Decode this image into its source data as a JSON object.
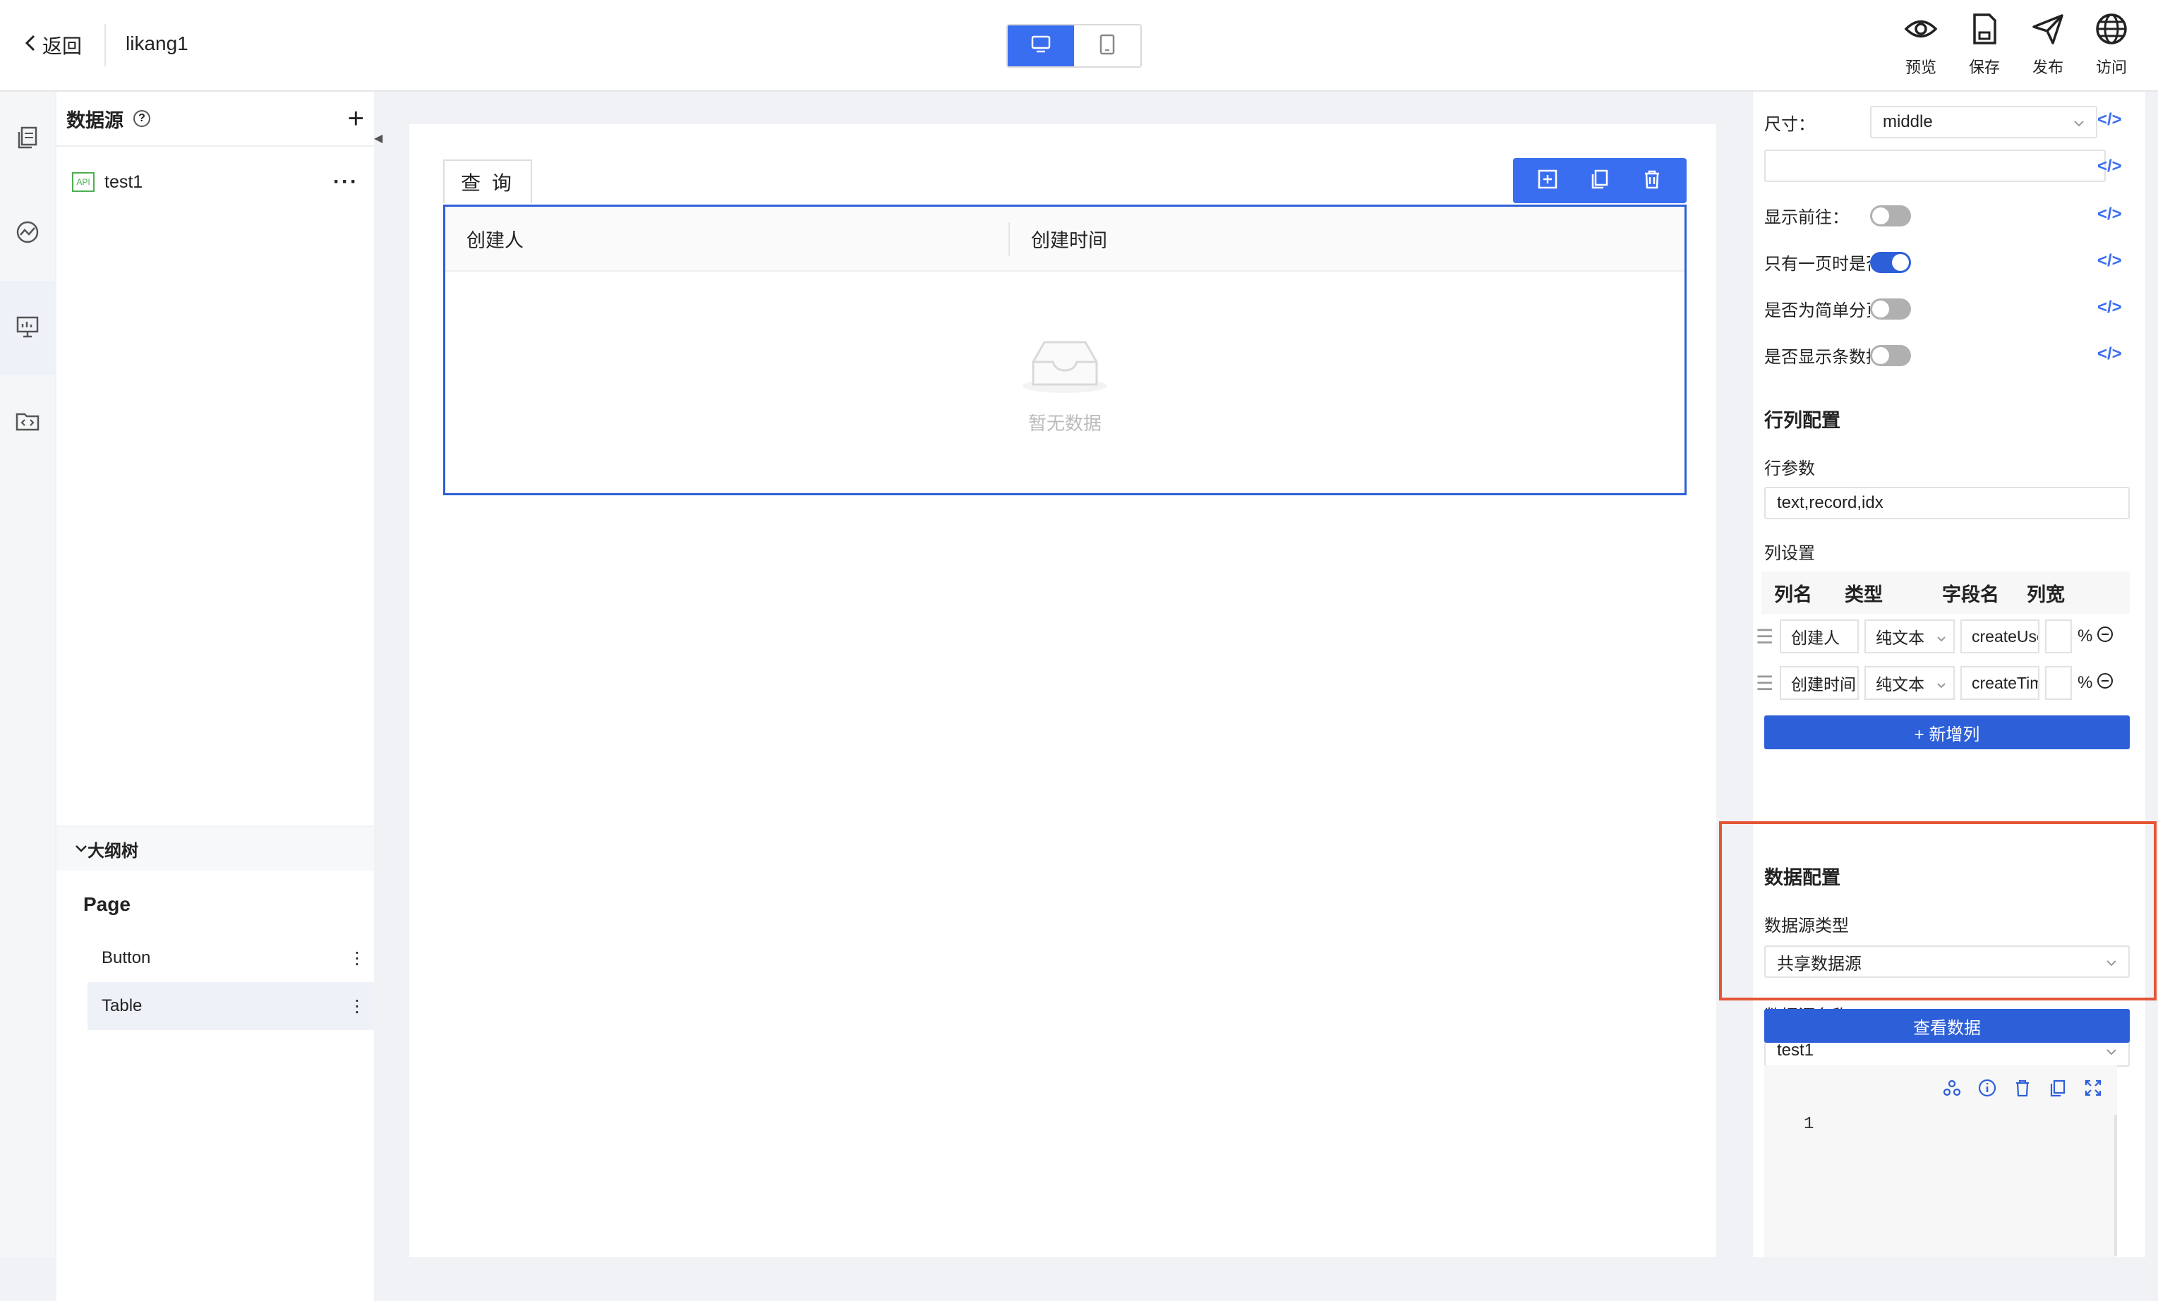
{
  "header": {
    "back_label": "返回",
    "page_name": "likang1",
    "tools": [
      {
        "icon": "eye-icon",
        "label": "预览"
      },
      {
        "icon": "save-icon",
        "label": "保存"
      },
      {
        "icon": "send-icon",
        "label": "发布"
      },
      {
        "icon": "globe-icon",
        "label": "访问"
      }
    ]
  },
  "datasource_panel": {
    "title": "数据源",
    "items": [
      {
        "label": "test1",
        "badge": "API"
      }
    ]
  },
  "outline": {
    "title": "大纲树",
    "root": "Page",
    "nodes": [
      "Button",
      "Table"
    ]
  },
  "canvas": {
    "query_button": "查 询",
    "table": {
      "columns": [
        "创建人",
        "创建时间"
      ],
      "empty_text": "暂无数据"
    }
  },
  "props": {
    "size_label": "尺寸：",
    "size_value": "middle",
    "show_goto_label": "显示前往：",
    "single_page_label": "只有一页时是否",
    "simple_pager_label": "是否为简单分页",
    "show_count_label": "是否显示条数据",
    "rowcol_section": "行列配置",
    "row_params_label": "行参数",
    "row_params_value": "text,record,idx",
    "col_settings_label": "列设置",
    "col_headers": [
      "列名",
      "类型",
      "字段名",
      "列宽"
    ],
    "col_rows": [
      {
        "name": "创建人",
        "type": "纯文本",
        "field": "createUser",
        "unit": "%"
      },
      {
        "name": "创建时间",
        "type": "纯文本",
        "field": "createTime",
        "unit": "%"
      }
    ],
    "add_col_button": "+ 新增列",
    "data_section": "数据配置",
    "ds_type_label": "数据源类型",
    "ds_type_value": "共享数据源",
    "ds_name_label": "数据源名称",
    "ds_name_value": "test1",
    "view_data_button": "查看数据",
    "editor_line": "1",
    "code_icon": "</>"
  }
}
